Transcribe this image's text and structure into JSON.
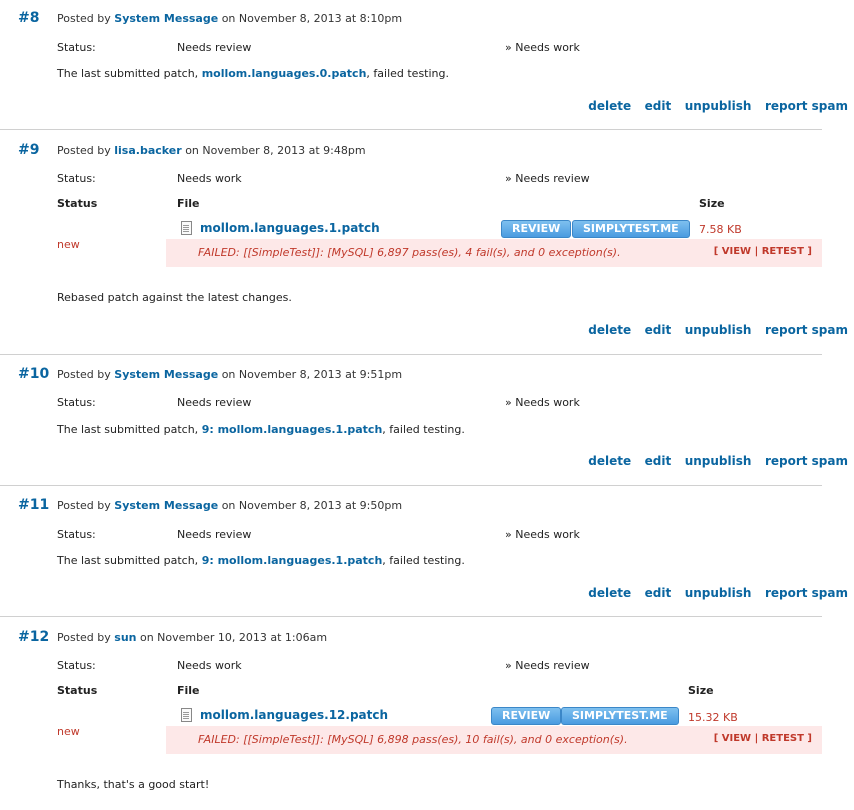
{
  "actions": [
    "delete",
    "edit",
    "unpublish",
    "report spam"
  ],
  "table_headers": {
    "status": "Status",
    "file": "File",
    "size": "Size"
  },
  "comments": [
    {
      "num": "#8",
      "posted_by": "Posted by",
      "author": "System Message",
      "date": "on November 8, 2013 at 8:10pm",
      "status_label": "Status:",
      "status_from": "Needs review",
      "status_to": "» Needs work",
      "text_before": "The last submitted patch,",
      "text_link": "mollom.languages.0.patch",
      "text_after": ", failed testing."
    },
    {
      "num": "#9",
      "posted_by": "Posted by",
      "author": "lisa.backer",
      "date": "on November 8, 2013 at 9:48pm",
      "status_label": "Status:",
      "status_from": "Needs work",
      "status_to": "» Needs review",
      "file": {
        "status": "new",
        "name": "mollom.languages.1.patch",
        "review": "REVIEW",
        "simplytest": "SIMPLYTEST.ME",
        "size": "7.58 KB",
        "failed": "FAILED: [[SimpleTest]]: [MySQL] 6,897 pass(es), 4 fail(s), and 0 exception(s).",
        "view": "VIEW",
        "retest": "RETEST"
      },
      "text": "Rebased patch against the latest changes."
    },
    {
      "num": "#10",
      "posted_by": "Posted by",
      "author": "System Message",
      "date": "on November 8, 2013 at 9:51pm",
      "status_label": "Status:",
      "status_from": "Needs review",
      "status_to": "» Needs work",
      "text_before": "The last submitted patch,",
      "text_link": "9: mollom.languages.1.patch",
      "text_after": ", failed testing."
    },
    {
      "num": "#11",
      "posted_by": "Posted by",
      "author": "System Message",
      "date": "on November 8, 2013 at 9:50pm",
      "status_label": "Status:",
      "status_from": "Needs review",
      "status_to": "» Needs work",
      "text_before": "The last submitted patch,",
      "text_link": "9: mollom.languages.1.patch",
      "text_after": ", failed testing."
    },
    {
      "num": "#12",
      "posted_by": "Posted by",
      "author": "sun",
      "date": "on November 10, 2013 at 1:06am",
      "status_label": "Status:",
      "status_from": "Needs work",
      "status_to": "» Needs review",
      "file": {
        "status": "new",
        "name": "mollom.languages.12.patch",
        "review": "REVIEW",
        "simplytest": "SIMPLYTEST.ME",
        "size": "15.32 KB",
        "failed": "FAILED: [[SimpleTest]]: [MySQL] 6,898 pass(es), 10 fail(s), and 0 exception(s).",
        "view": "VIEW",
        "retest": "RETEST"
      },
      "text": "Thanks, that's a good start!"
    }
  ]
}
